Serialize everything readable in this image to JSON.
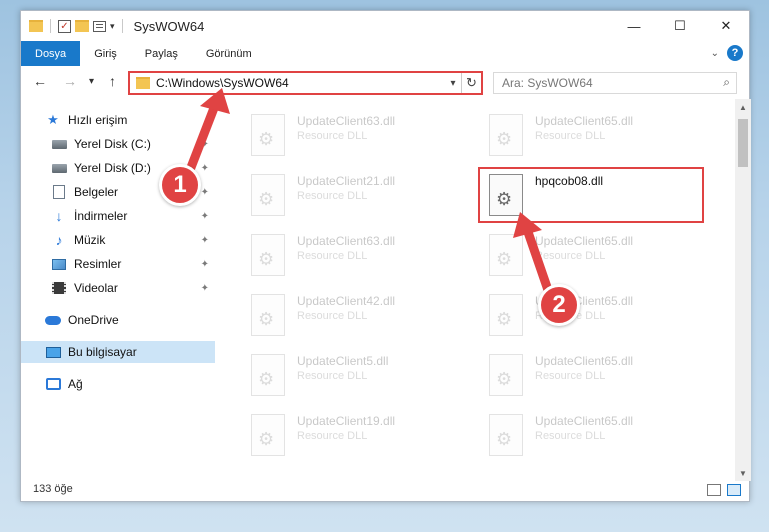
{
  "window": {
    "title": "SysWOW64",
    "controls": {
      "minimize": "—",
      "maximize": "☐",
      "close": "✕"
    }
  },
  "ribbon": {
    "tabs": [
      "Dosya",
      "Giriş",
      "Paylaş",
      "Görünüm"
    ],
    "active_tab": "Dosya",
    "help": "?"
  },
  "navigation": {
    "back": "←",
    "forward": "→",
    "recent": "▾",
    "up": "↑",
    "address": "C:\\Windows\\SysWOW64",
    "address_dropdown": "▾",
    "refresh": "↻",
    "search_placeholder": "Ara: SysWOW64",
    "search_icon": "⌕"
  },
  "sidebar": {
    "items": [
      {
        "label": "Hızlı erişim",
        "icon": "star-icon"
      },
      {
        "label": "Yerel Disk (C:)",
        "icon": "drive-icon",
        "pinned": true
      },
      {
        "label": "Yerel Disk (D:)",
        "icon": "drive-icon",
        "pinned": true
      },
      {
        "label": "Belgeler",
        "icon": "document-icon",
        "pinned": true
      },
      {
        "label": "İndirmeler",
        "icon": "download-icon",
        "pinned": true
      },
      {
        "label": "Müzik",
        "icon": "music-icon",
        "pinned": true
      },
      {
        "label": "Resimler",
        "icon": "pictures-icon",
        "pinned": true
      },
      {
        "label": "Videolar",
        "icon": "videos-icon",
        "pinned": true
      },
      {
        "label": "OneDrive",
        "icon": "cloud-icon"
      },
      {
        "label": "Bu bilgisayar",
        "icon": "computer-icon",
        "selected": true
      },
      {
        "label": "Ağ",
        "icon": "network-icon"
      }
    ],
    "pin_glyph": "📌"
  },
  "files": [
    {
      "name": "UpdateClient63.dll",
      "type": "Resource DLL",
      "faded": true
    },
    {
      "name": "UpdateClient65.dll",
      "type": "Resource DLL",
      "faded": true
    },
    {
      "name": "UpdateClient21.dll",
      "type": "Resource DLL",
      "faded": true
    },
    {
      "name": "hpqcob08.dll",
      "type": "",
      "faded": false
    },
    {
      "name": "UpdateClient63.dll",
      "type": "Resource DLL",
      "faded": true
    },
    {
      "name": "UpdateClient65.dll",
      "type": "Resource DLL",
      "faded": true
    },
    {
      "name": "UpdateClient42.dll",
      "type": "Resource DLL",
      "faded": true
    },
    {
      "name": "UpdateClient65.dll",
      "type": "Resource DLL",
      "faded": true
    },
    {
      "name": "UpdateClient5.dll",
      "type": "Resource DLL",
      "faded": true
    },
    {
      "name": "UpdateClient65.dll",
      "type": "Resource DLL",
      "faded": true
    },
    {
      "name": "UpdateClient19.dll",
      "type": "Resource DLL",
      "faded": true
    },
    {
      "name": "UpdateClient65.dll",
      "type": "Resource DLL",
      "faded": true
    }
  ],
  "status": {
    "count": "133 öğe"
  },
  "annotations": [
    {
      "number": "1",
      "target": "address-bar"
    },
    {
      "number": "2",
      "target": "hpqcob08.dll"
    }
  ],
  "colors": {
    "accent": "#1979ca",
    "highlight": "#e04343",
    "selected": "#cce4f7"
  }
}
